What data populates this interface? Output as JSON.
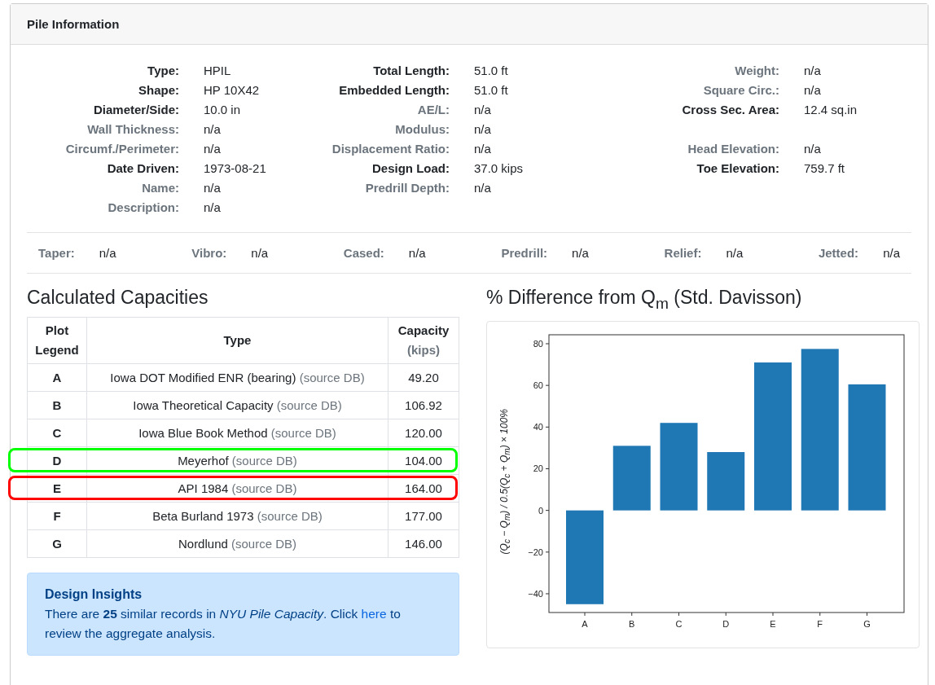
{
  "card": {
    "title": "Pile Information"
  },
  "field_columns": [
    [
      {
        "kind": "field",
        "label": "Type:",
        "value": "HPIL",
        "dimmed": false
      },
      {
        "kind": "field",
        "label": "Shape:",
        "value": "HP 10X42",
        "dimmed": false
      },
      {
        "kind": "field",
        "label": "Diameter/Side:",
        "value": "10.0 in",
        "dimmed": false
      },
      {
        "kind": "field",
        "label": "Wall Thickness:",
        "value": "n/a",
        "dimmed": true
      },
      {
        "kind": "field",
        "label": "Circumf./Perimeter:",
        "value": "n/a",
        "dimmed": true
      },
      {
        "kind": "field",
        "label": "Date Driven:",
        "value": "1973-08-21",
        "dimmed": false
      },
      {
        "kind": "field",
        "label": "Name:",
        "value": "n/a",
        "dimmed": true
      },
      {
        "kind": "field",
        "label": "Description:",
        "value": "n/a",
        "dimmed": true
      }
    ],
    [
      {
        "kind": "field",
        "label": "Total Length:",
        "value": "51.0 ft",
        "dimmed": false
      },
      {
        "kind": "field",
        "label": "Embedded Length:",
        "value": "51.0 ft",
        "dimmed": false
      },
      {
        "kind": "field",
        "label": "AE/L:",
        "value": "n/a",
        "dimmed": true
      },
      {
        "kind": "field",
        "label": "Modulus:",
        "value": "n/a",
        "dimmed": true
      },
      {
        "kind": "field",
        "label": "Displacement Ratio:",
        "value": "n/a",
        "dimmed": true
      },
      {
        "kind": "field",
        "label": "Design Load:",
        "value": "37.0 kips",
        "dimmed": false
      },
      {
        "kind": "field",
        "label": "Predrill Depth:",
        "value": "n/a",
        "dimmed": true
      }
    ],
    [
      {
        "kind": "field",
        "label": "Weight:",
        "value": "n/a",
        "dimmed": true
      },
      {
        "kind": "field",
        "label": "Square Circ.:",
        "value": "n/a",
        "dimmed": true
      },
      {
        "kind": "field",
        "label": "Cross Sec. Area:",
        "value": "12.4 sq.in",
        "dimmed": false
      },
      {
        "kind": "blank"
      },
      {
        "kind": "field",
        "label": "Head Elevation:",
        "value": "n/a",
        "dimmed": true
      },
      {
        "kind": "field",
        "label": "Toe Elevation:",
        "value": "759.7 ft",
        "dimmed": false
      }
    ]
  ],
  "flags": [
    {
      "label": "Taper:",
      "value": "n/a"
    },
    {
      "label": "Vibro:",
      "value": "n/a"
    },
    {
      "label": "Cased:",
      "value": "n/a"
    },
    {
      "label": "Predrill:",
      "value": "n/a"
    },
    {
      "label": "Relief:",
      "value": "n/a"
    },
    {
      "label": "Jetted:",
      "value": "n/a"
    }
  ],
  "capacities": {
    "heading": "Calculated Capacities",
    "columns": [
      {
        "title": "Plot Legend"
      },
      {
        "title": "Type"
      },
      {
        "title": "Capacity",
        "unit": "(kips)"
      }
    ],
    "rows": [
      {
        "legend": "A",
        "type": "Iowa DOT Modified ENR (bearing)",
        "source": "(source DB)",
        "capacity": "49.20"
      },
      {
        "legend": "B",
        "type": "Iowa Theoretical Capacity",
        "source": "(source DB)",
        "capacity": "106.92"
      },
      {
        "legend": "C",
        "type": "Iowa Blue Book Method",
        "source": "(source DB)",
        "capacity": "120.00"
      },
      {
        "legend": "D",
        "type": "Meyerhof",
        "source": "(source DB)",
        "capacity": "104.00",
        "color": "#00ff00"
      },
      {
        "legend": "E",
        "type": "API 1984",
        "source": "(source DB)",
        "capacity": "164.00",
        "color": "#ff0000"
      },
      {
        "legend": "F",
        "type": "Beta Burland 1973",
        "source": "(source DB)",
        "capacity": "177.00"
      },
      {
        "legend": "G",
        "type": "Nordlund",
        "source": "(source DB)",
        "capacity": "146.00"
      }
    ]
  },
  "insights": {
    "title": "Design Insights",
    "text_before": "There are **25** similar records in *NYU Pile Capacity*. Click",
    "link": "here",
    "text_after": "to review the aggregate analysis."
  },
  "difference": {
    "heading": "% Difference from Q$_{m}$ (Std. Davisson)",
    "chart_data": {
      "type": "bar",
      "ylabel": "(Q$_{c}$ − Q$_{m}$) / 0.5(Q$_{c}$ + Q$_{m}$) × 100%",
      "categories": [
        "A",
        "B",
        "C",
        "D",
        "E",
        "F",
        "G"
      ],
      "series": [
        {
          "color": "#1f77b4",
          "values": [
            -45,
            31,
            42,
            28,
            71,
            77.5,
            60.5
          ]
        }
      ],
      "ylim": [
        -49,
        84.3
      ],
      "yticks": [
        {
          "value": -40,
          "label": "−40"
        },
        {
          "value": -20,
          "label": "−20"
        },
        0,
        20,
        40,
        60,
        80
      ]
    }
  }
}
